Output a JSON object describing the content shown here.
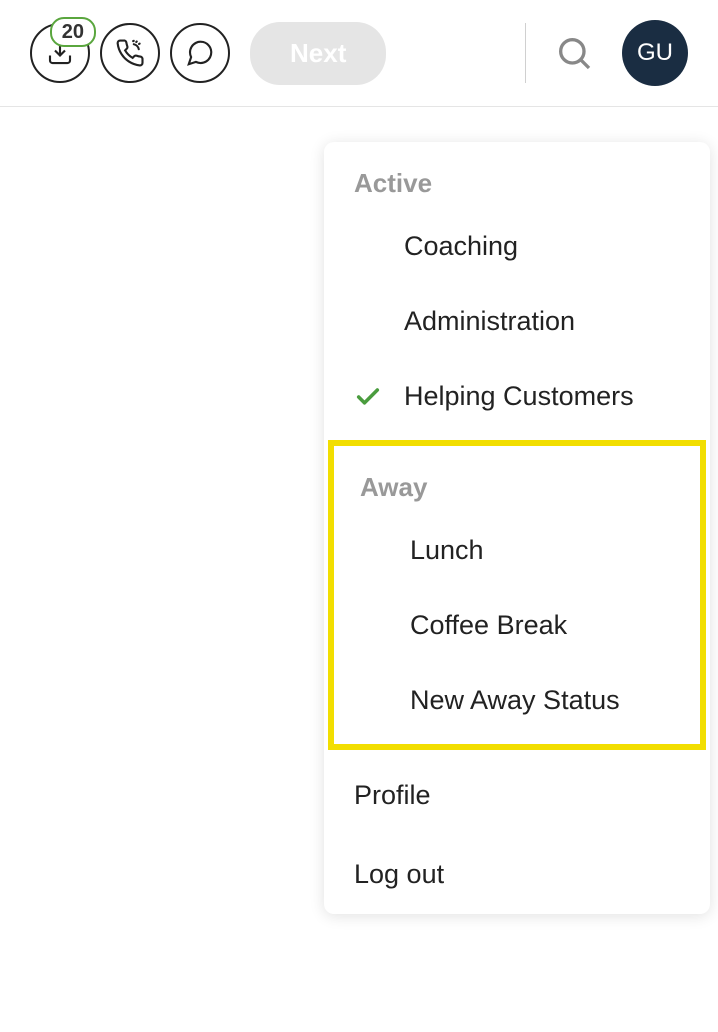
{
  "header": {
    "inbox_badge": "20",
    "next_label": "Next",
    "avatar_initials": "GU"
  },
  "dropdown": {
    "active_header": "Active",
    "active_items": [
      {
        "label": "Coaching",
        "selected": false
      },
      {
        "label": "Administration",
        "selected": false
      },
      {
        "label": "Helping Customers",
        "selected": true
      }
    ],
    "away_header": "Away",
    "away_items": [
      {
        "label": "Lunch"
      },
      {
        "label": "Coffee Break"
      },
      {
        "label": "New Away Status"
      }
    ],
    "profile_label": "Profile",
    "logout_label": "Log out"
  }
}
